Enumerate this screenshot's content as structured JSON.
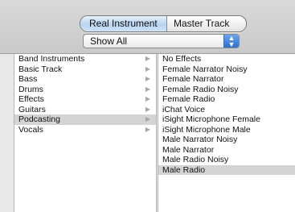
{
  "segmented": {
    "options": [
      "Real Instrument",
      "Master Track"
    ],
    "selected": "Real Instrument",
    "accent_color": "#b8d4f1"
  },
  "filter_popup": {
    "value": "Show All",
    "icon": "up-down-arrows-icon"
  },
  "categories": [
    {
      "label": "Band Instruments"
    },
    {
      "label": "Basic Track"
    },
    {
      "label": "Bass"
    },
    {
      "label": "Drums"
    },
    {
      "label": "Effects"
    },
    {
      "label": "Guitars"
    },
    {
      "label": "Podcasting",
      "selected": true
    },
    {
      "label": "Vocals"
    }
  ],
  "presets": [
    {
      "label": "No Effects"
    },
    {
      "label": "Female Narrator Noisy"
    },
    {
      "label": "Female Narrator"
    },
    {
      "label": "Female Radio Noisy"
    },
    {
      "label": "Female Radio"
    },
    {
      "label": "iChat Voice"
    },
    {
      "label": "iSight Microphone Female"
    },
    {
      "label": "iSight Microphone Male"
    },
    {
      "label": "Male Narrator Noisy"
    },
    {
      "label": "Male Narrator"
    },
    {
      "label": "Male Radio Noisy"
    },
    {
      "label": "Male Radio",
      "selected": true
    }
  ],
  "colors": {
    "selection": "#d4d4d4",
    "popup_arrow_blue": "#2f6fd1"
  }
}
